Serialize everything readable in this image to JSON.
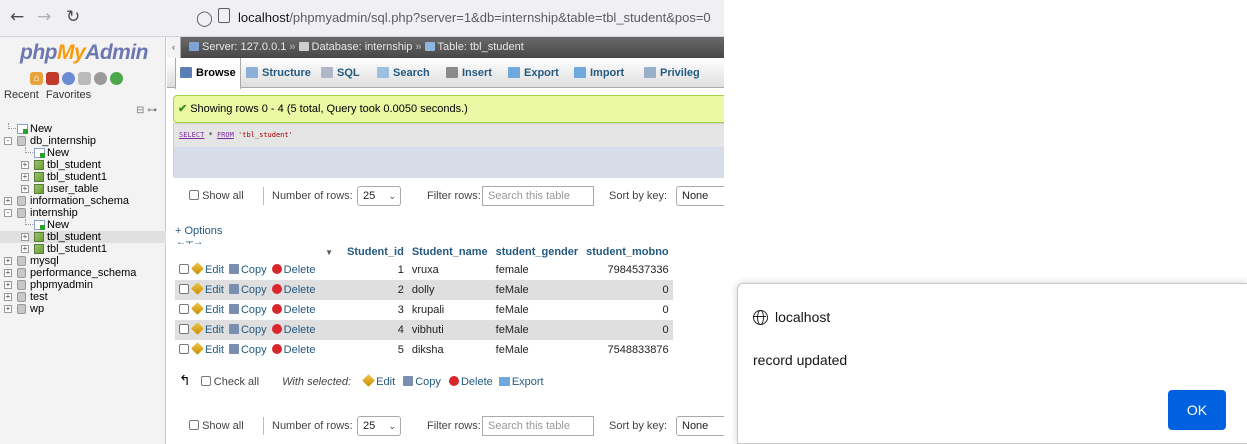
{
  "browser": {
    "url_host": "localhost",
    "url_path": "/phpmyadmin/sql.php?server=1&db=internship&table=tbl_student&pos=0"
  },
  "pma": {
    "logo_php": "php",
    "logo_my": "My",
    "logo_admin": "Admin",
    "recent_label": "Recent",
    "favorites_label": "Favorites"
  },
  "tree": [
    {
      "label": "New",
      "level": 0,
      "icon": "new"
    },
    {
      "label": "db_internship",
      "level": 0,
      "icon": "db",
      "expander": "-"
    },
    {
      "label": "New",
      "level": 1,
      "icon": "new"
    },
    {
      "label": "tbl_student",
      "level": 1,
      "icon": "table",
      "expander": "+"
    },
    {
      "label": "tbl_student1",
      "level": 1,
      "icon": "table",
      "expander": "+"
    },
    {
      "label": "user_table",
      "level": 1,
      "icon": "table",
      "expander": "+"
    },
    {
      "label": "information_schema",
      "level": 0,
      "icon": "db",
      "expander": "+"
    },
    {
      "label": "internship",
      "level": 0,
      "icon": "db",
      "expander": "-"
    },
    {
      "label": "New",
      "level": 1,
      "icon": "new"
    },
    {
      "label": "tbl_student",
      "level": 1,
      "icon": "table",
      "expander": "+",
      "selected": true
    },
    {
      "label": "tbl_student1",
      "level": 1,
      "icon": "table",
      "expander": "+"
    },
    {
      "label": "mysql",
      "level": 0,
      "icon": "db",
      "expander": "+"
    },
    {
      "label": "performance_schema",
      "level": 0,
      "icon": "db",
      "expander": "+"
    },
    {
      "label": "phpmyadmin",
      "level": 0,
      "icon": "db",
      "expander": "+"
    },
    {
      "label": "test",
      "level": 0,
      "icon": "db",
      "expander": "+"
    },
    {
      "label": "wp",
      "level": 0,
      "icon": "db",
      "expander": "+"
    }
  ],
  "breadcrumb": {
    "server": "Server: 127.0.0.1",
    "database": "Database: internship",
    "table": "Table: tbl_student"
  },
  "tabs": [
    {
      "label": "Browse",
      "icon": "browse-icon",
      "color": "#5b7fb5"
    },
    {
      "label": "Structure",
      "icon": "structure-icon",
      "color": "#8ab0d8"
    },
    {
      "label": "SQL",
      "icon": "sql-icon",
      "color": "#b0b8c8"
    },
    {
      "label": "Search",
      "icon": "search-icon",
      "color": "#9ec0e0"
    },
    {
      "label": "Insert",
      "icon": "insert-icon",
      "color": "#8a8a8a"
    },
    {
      "label": "Export",
      "icon": "export-icon",
      "color": "#6fa8dc"
    },
    {
      "label": "Import",
      "icon": "import-icon",
      "color": "#6fa8dc"
    },
    {
      "label": "Privileg",
      "icon": "privileges-icon",
      "color": "#9ab0c8"
    }
  ],
  "message": {
    "success": "Showing rows 0 - 4 (5 total, Query took 0.0050 seconds.)"
  },
  "sql": {
    "select": "SELECT",
    "star": " * ",
    "from": "FROM",
    "table": " 'tbl_student'"
  },
  "controls": {
    "show_all": "Show all",
    "number_of_rows": "Number of rows:",
    "rows_value": "25",
    "filter_rows": "Filter rows:",
    "search_placeholder": "Search this table",
    "sort_by_key": "Sort by key:",
    "sort_value": "None"
  },
  "results": {
    "options": "+ Options",
    "actions": {
      "edit": "Edit",
      "copy": "Copy",
      "delete": "Delete"
    },
    "columns": [
      "Student_id",
      "Student_name",
      "student_gender",
      "student_mobno"
    ],
    "rows": [
      [
        "1",
        "vruxa",
        "female",
        "7984537336"
      ],
      [
        "2",
        "dolly",
        "feMale",
        "0"
      ],
      [
        "3",
        "krupali",
        "feMale",
        "0"
      ],
      [
        "4",
        "vibhuti",
        "feMale",
        "0"
      ],
      [
        "5",
        "diksha",
        "feMale",
        "7548833876"
      ]
    ]
  },
  "bulk": {
    "check_all": "Check all",
    "with_selected": "With selected:",
    "edit": "Edit",
    "copy": "Copy",
    "delete": "Delete",
    "export": "Export"
  },
  "alert": {
    "origin": "localhost",
    "message": "record updated",
    "ok_label": "OK"
  }
}
